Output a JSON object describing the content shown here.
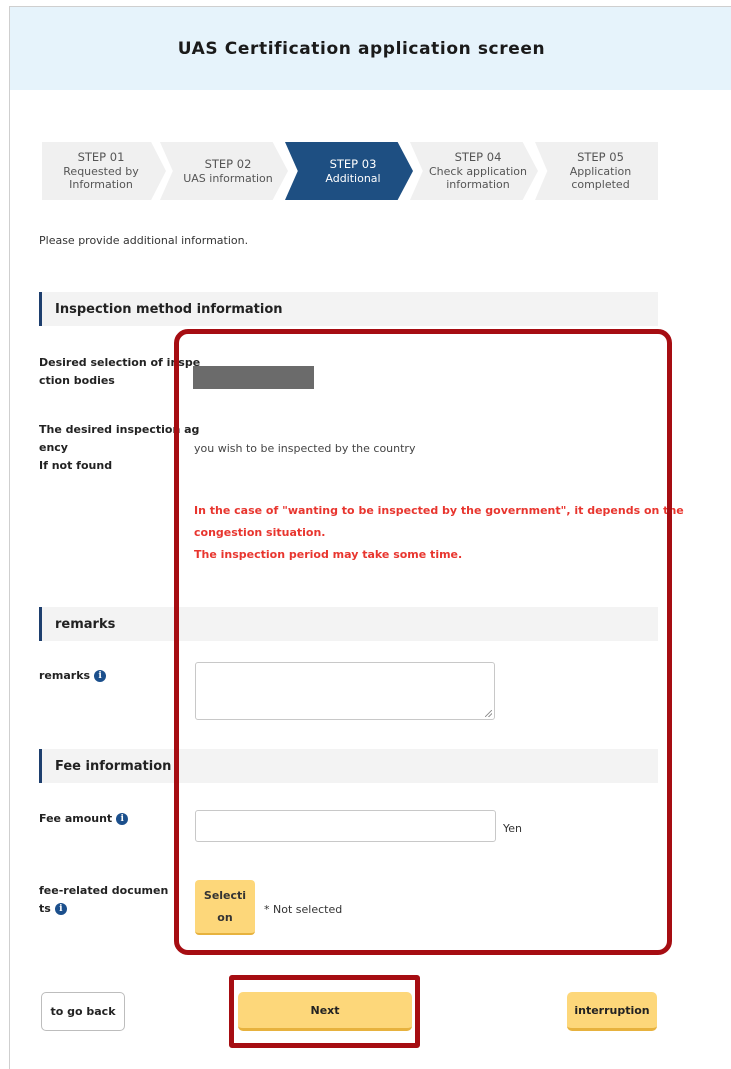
{
  "header": {
    "title": "UAS Certification application screen"
  },
  "steps": [
    {
      "num": "STEP 01",
      "line1": "Requested by",
      "line2": "Information",
      "active": false
    },
    {
      "num": "STEP 02",
      "line1": "UAS information",
      "line2": "",
      "active": false
    },
    {
      "num": "STEP 03",
      "line1": "Additional",
      "line2": "",
      "active": true
    },
    {
      "num": "STEP 04",
      "line1": "Check application",
      "line2": "information",
      "active": false
    },
    {
      "num": "STEP 05",
      "line1": "Application",
      "line2": "completed",
      "active": false
    }
  ],
  "intro": "Please provide additional information.",
  "inspection": {
    "section_title": "Inspection method information",
    "desired_bodies_label_1": "Desired selection of inspe",
    "desired_bodies_label_2": "ction bodies",
    "fallback_label_1": "The desired inspection ag",
    "fallback_label_2": "ency",
    "fallback_label_3": "If not found",
    "fallback_value": "you wish to be inspected by the country",
    "warning_1": "In the case of \"wanting to be inspected by the government\", it depends on the",
    "warning_2": "congestion situation.",
    "warning_3": "The inspection period may take some time."
  },
  "remarks": {
    "section_title": "remarks",
    "label": "remarks"
  },
  "fee": {
    "section_title": "Fee information",
    "amount_label": "Fee amount",
    "unit": "Yen",
    "docs_label_1": "fee-related documen",
    "docs_label_2": "ts",
    "select_line1": "Selecti",
    "select_line2": "on",
    "docs_status": "* Not selected"
  },
  "buttons": {
    "back": "to go back",
    "next": "Next",
    "interruption": "interruption"
  },
  "icons": {
    "info": "info-icon",
    "info_glyph": "i"
  },
  "colors": {
    "accent": "#1e4f82",
    "button": "#fdd77a",
    "warning": "#e8352e",
    "highlight": "#a60d12",
    "header_bg": "#e6f3fb"
  }
}
